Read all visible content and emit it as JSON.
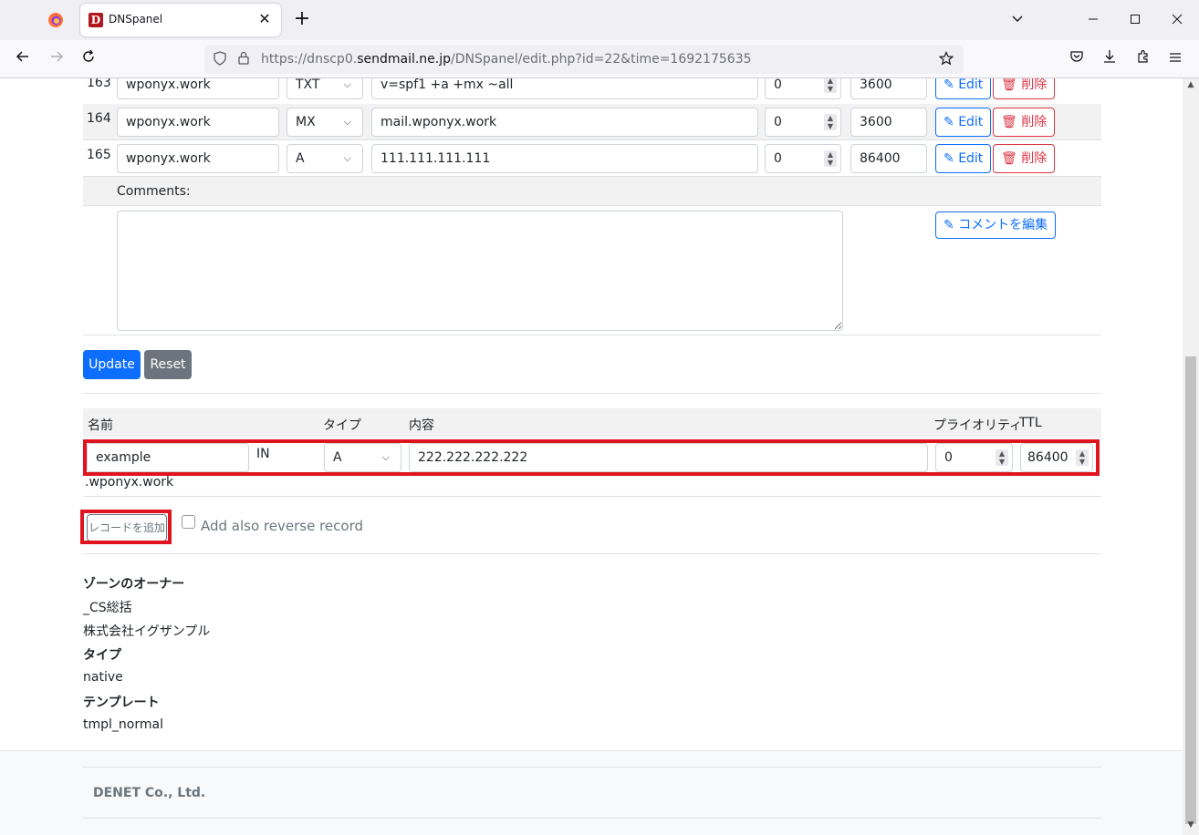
{
  "browser": {
    "tab_title": "DNSpanel",
    "favicon_letter": "D",
    "url_prefix": "https://dnscp0.",
    "url_domain": "sendmail.ne.jp",
    "url_path": "/DNSpanel/edit.php?id=22&time=1692175635"
  },
  "records": [
    {
      "num": "163",
      "name": "wponyx.work",
      "type": "TXT",
      "content": "v=spf1 +a +mx ~all",
      "priority": "0",
      "ttl": "3600",
      "edit": "Edit",
      "delete": "削除"
    },
    {
      "num": "164",
      "name": "wponyx.work",
      "type": "MX",
      "content": "mail.wponyx.work",
      "priority": "0",
      "ttl": "3600",
      "edit": "Edit",
      "delete": "削除"
    },
    {
      "num": "165",
      "name": "wponyx.work",
      "type": "A",
      "content": "111.111.111.111",
      "priority": "0",
      "ttl": "86400",
      "edit": "Edit",
      "delete": "削除"
    }
  ],
  "comments": {
    "label": "Comments:",
    "value": "",
    "edit_button": "コメントを編集"
  },
  "form_buttons": {
    "update": "Update",
    "reset": "Reset"
  },
  "add_form": {
    "headers": {
      "name": "名前",
      "type": "タイプ",
      "content": "内容",
      "priority": "プライオリティ",
      "ttl": "TTL"
    },
    "name_value": "example",
    "class_label": "IN",
    "type_value": "A",
    "content_value": "222.222.222.222",
    "priority_value": "0",
    "ttl_value": "86400",
    "domain_suffix": ".wponyx.work",
    "add_button": "レコードを追加",
    "reverse_label": "Add also reverse record",
    "reverse_checked": false
  },
  "zone_info": {
    "owner_label": "ゾーンのオーナー",
    "owner_1": "_CS総括",
    "owner_2": "株式会社イグザンプル",
    "type_label": "タイプ",
    "type_value": "native",
    "template_label": "テンプレート",
    "template_value": "tmpl_normal"
  },
  "footer": {
    "company": "DENET Co., Ltd."
  },
  "colors": {
    "highlight": "#e0141e",
    "primary": "#0d6efd",
    "danger": "#dc3545",
    "secondary": "#6c757d"
  }
}
